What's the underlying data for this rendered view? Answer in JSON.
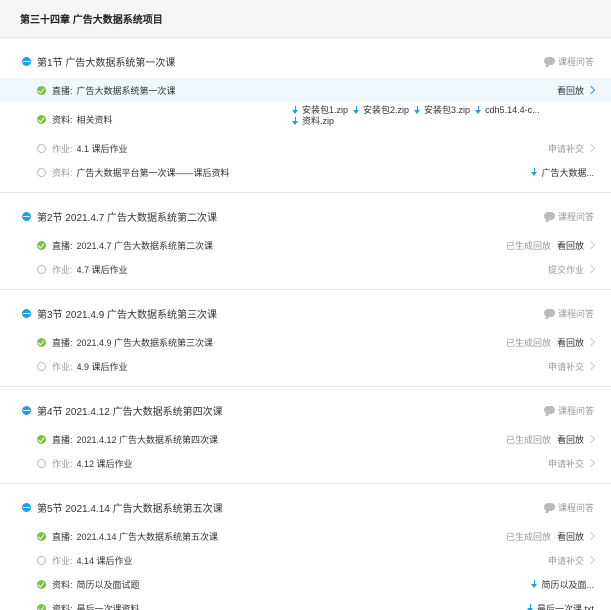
{
  "chapter": {
    "title": "第三十四章 广告大数据系统项目"
  },
  "qa_label": "课程问答",
  "sec1": {
    "title": "第1节   广告大数据系统第一次课",
    "live_type": "直播:",
    "live_title": "广告大数据系统第一次课",
    "live_action": "看回放",
    "res_type": "资料:",
    "res_title": "相关资料",
    "files": [
      "安装包1.zip",
      "安装包2.zip",
      "安装包3.zip",
      "cdh5.14.4-c...",
      "资料.zip"
    ],
    "hw_type": "作业:",
    "hw_title": "4.1 课后作业",
    "hw_action": "申请补交",
    "res2_type": "资料:",
    "res2_title": "广告大数据平台第一次课——课后资料",
    "res2_file": "广告大数据..."
  },
  "sec2": {
    "title": "第2节   2021.4.7 广告大数据系统第二次课",
    "live_type": "直播:",
    "live_title": "2021.4.7 广告大数据系统第二次课",
    "live_status": "已生成回放",
    "live_action": "看回放",
    "hw_type": "作业:",
    "hw_title": "4.7 课后作业",
    "hw_action": "提交作业"
  },
  "sec3": {
    "title": "第3节   2021.4.9 广告大数据系统第三次课",
    "live_type": "直播:",
    "live_title": "2021.4.9 广告大数据系统第三次课",
    "live_status": "已生成回放",
    "live_action": "看回放",
    "hw_type": "作业:",
    "hw_title": "4.9 课后作业",
    "hw_action": "申请补交"
  },
  "sec4": {
    "title": "第4节   2021.4.12 广告大数据系统第四次课",
    "live_type": "直播:",
    "live_title": "2021.4.12 广告大数据系统第四次课",
    "live_status": "已生成回放",
    "live_action": "看回放",
    "hw_type": "作业:",
    "hw_title": "4.12 课后作业",
    "hw_action": "申请补交"
  },
  "sec5": {
    "title": "第5节   2021.4.14 广告大数据系统第五次课",
    "live_type": "直播:",
    "live_title": "2021.4.14 广告大数据系统第五次课",
    "live_status": "已生成回放",
    "live_action": "看回放",
    "hw_type": "作业:",
    "hw_title": "4.14 课后作业",
    "hw_action": "申请补交",
    "res_type": "资料:",
    "res_title": "简历以及面试题",
    "res_file": "简历以及面...",
    "res2_type": "资料:",
    "res2_title": "最后一次课资料",
    "res2_file": "最后一次课.txt"
  },
  "colors": {
    "accent": "#1ba1e2",
    "done": "#7bc043",
    "highlight": "#eff8fd"
  }
}
